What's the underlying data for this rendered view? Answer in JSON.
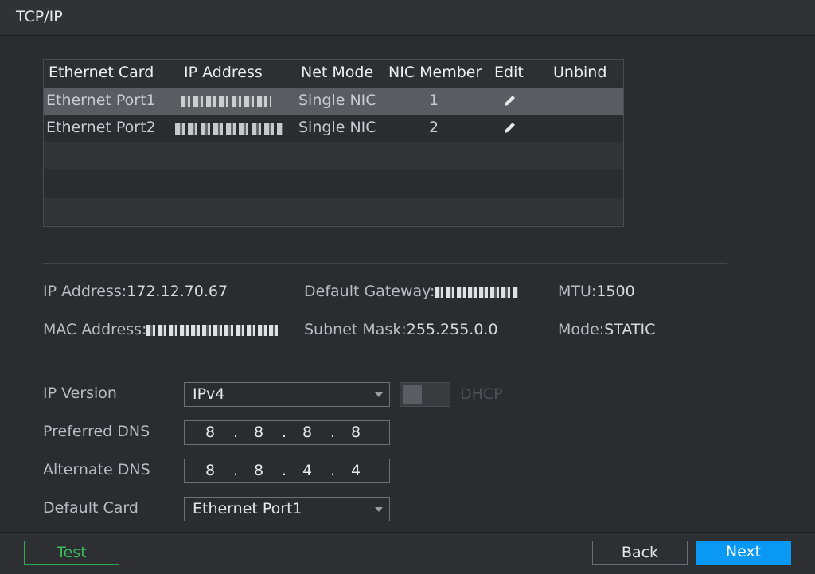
{
  "window": {
    "title": "TCP/IP"
  },
  "table": {
    "headers": [
      "Ethernet Card",
      "IP Address",
      "Net Mode",
      "NIC Member",
      "Edit",
      "Unbind"
    ],
    "rows": [
      {
        "card": "Ethernet Port1",
        "mode": "Single NIC",
        "member": "1"
      },
      {
        "card": "Ethernet Port2",
        "mode": "Single NIC",
        "member": "2"
      }
    ]
  },
  "info": {
    "ip_label": "IP Address:",
    "ip_value": "172.12.70.67",
    "gateway_label": "Default Gateway:",
    "mtu_label": "MTU:",
    "mtu_value": "1500",
    "mac_label": "MAC Address:",
    "subnet_label": "Subnet Mask:",
    "subnet_value": "255.255.0.0",
    "mode_label": "Mode:",
    "mode_value": "STATIC"
  },
  "form": {
    "ip_version_label": "IP Version",
    "ip_version_value": "IPv4",
    "dhcp_label": "DHCP",
    "preferred_dns_label": "Preferred DNS",
    "preferred_dns": [
      "8",
      "8",
      "8",
      "8"
    ],
    "alternate_dns_label": "Alternate DNS",
    "alternate_dns": [
      "8",
      "8",
      "4",
      "4"
    ],
    "default_card_label": "Default Card",
    "default_card_value": "Ethernet Port1"
  },
  "buttons": {
    "test": "Test",
    "back": "Back",
    "next": "Next"
  },
  "colors": {
    "accent": "#0a98f5",
    "test_green": "#39b85c",
    "background": "#2b2c2f"
  }
}
